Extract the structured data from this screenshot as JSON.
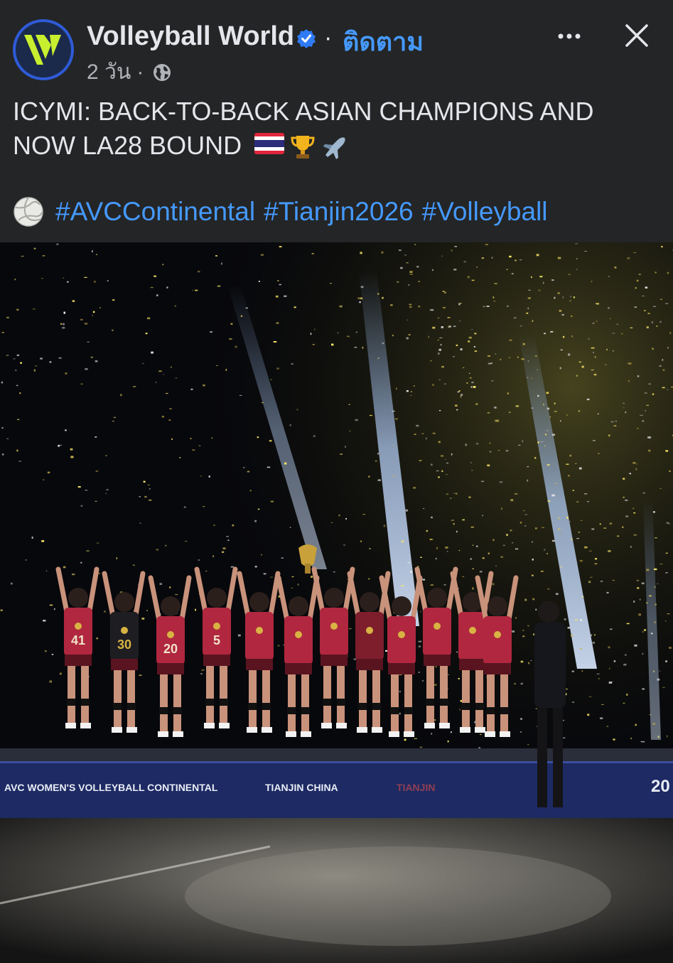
{
  "header": {
    "page_name": "Volleyball World",
    "separator": "·",
    "follow_label": "ติดตาม",
    "time_ago": "2 วัน",
    "meta_separator": "·",
    "privacy_icon": "globe-icon",
    "more_icon": "more-horizontal-icon",
    "close_icon": "close-icon",
    "verified_icon": "verified-badge-icon"
  },
  "post": {
    "caption": "ICYMI: BACK-TO-BACK ASIAN CHAMPIONS AND NOW LA28 BOUND",
    "caption_emojis": [
      "thailand-flag-icon",
      "trophy-icon",
      "airplane-icon"
    ],
    "leading_icon": "volleyball-icon",
    "hashtags": [
      "#AVCContinental",
      "#Tianjin2026",
      "#Volleyball"
    ]
  },
  "photo": {
    "board_left": "AVC WOMEN'S VOLLEYBALL CONTINENTAL",
    "board_middle": "TIANJIN CHINA",
    "board_right_faint": "TIANJIN",
    "board_far_right": "20",
    "jersey_numbers": [
      "41",
      "30",
      "20",
      "5"
    ]
  },
  "colors": {
    "background": "#242526",
    "text": "#e4e6eb",
    "secondary_text": "#b0b3b8",
    "link": "#4599ff",
    "verified": "#2f7bf5",
    "jersey_red": "#b0273f"
  }
}
